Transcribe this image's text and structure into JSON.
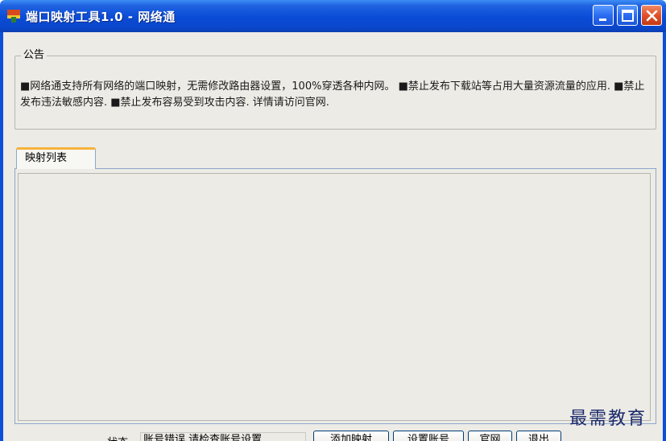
{
  "window": {
    "title": "端口映射工具1.0 - 网络通",
    "icon": "app-icon",
    "controls": [
      "minimize-icon",
      "maximize-icon",
      "close-icon"
    ]
  },
  "notice": {
    "legend": "公告",
    "text": "■网络通支持所有网络的端口映射，无需修改路由器设置，100%穿透各种内网。 ■禁止发布下载站等占用大量资源流量的应用. ■禁止发布违法敏感内容. ■禁止发布容易受到攻击内容. 详情请访问官网."
  },
  "tabs": [
    {
      "label": "映射列表",
      "selected": true
    }
  ],
  "status": {
    "label": "状态",
    "value": "账号错误,请检查账号设置"
  },
  "buttons": {
    "add_mapping": "添加映射",
    "account_settings": "设置账号",
    "website": "官网",
    "exit": "退出"
  },
  "watermark": "最需教育",
  "colors": {
    "titlebar": "#0a4bd6",
    "client_bg": "#ecebe6",
    "close_button": "#e0502a"
  }
}
